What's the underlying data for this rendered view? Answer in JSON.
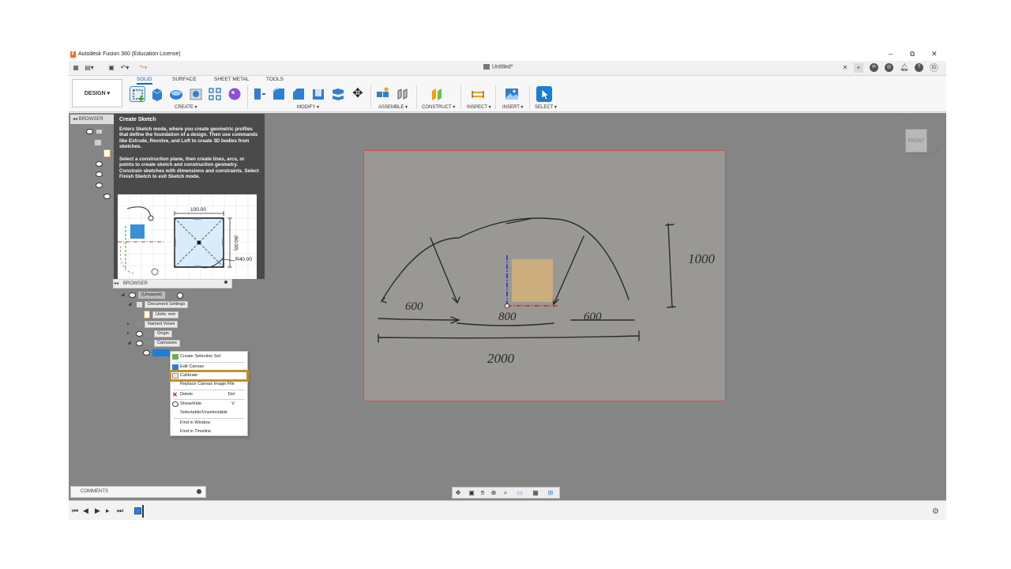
{
  "window": {
    "title": "Autodesk Fusion 360 (Education License)",
    "controls": [
      "–",
      "⧉",
      "✕"
    ]
  },
  "tabbar": {
    "doc_title": "Untitled*",
    "user_initials": "ID"
  },
  "ribbon": {
    "workspace": "DESIGN ▾",
    "tabs": [
      "SOLID",
      "SURFACE",
      "SHEET METAL",
      "TOOLS"
    ],
    "groups": [
      "CREATE ▾",
      "MODIFY ▾",
      "ASSEMBLE ▾",
      "CONSTRUCT ▾",
      "INSPECT ▾",
      "INSERT ▾",
      "SELECT ▾"
    ]
  },
  "browser": {
    "header": "BROWSER"
  },
  "tooltip": {
    "title": "Create Sketch",
    "para1": "Enters Sketch mode, where you create geometric profiles that define the foundation of a design. Then use commands like Extrude, Revolve, and Loft to create 3D bodies from sketches.",
    "para2": "Select a construction plane, then create lines, arcs, or points to create sketch and construction geometry. Constrain sketches with dimensions and constraints. Select Finish Sketch to exit Sketch mode.",
    "dim_top": "100.00",
    "dim_right": "(60.00)",
    "dim_radius": "R40.00"
  },
  "browser2": {
    "header": "BROWSER",
    "root": "(Unsaved)",
    "document_settings": "Document Settings",
    "units": "Units: mm",
    "named_views": "Named Views",
    "origin": "Origin",
    "canvases": "Canvases"
  },
  "context_menu": {
    "items": [
      {
        "label": "Create Selection Set",
        "shortcut": ""
      },
      {
        "label": "Edit Canvas",
        "shortcut": ""
      },
      {
        "label": "Calibrate",
        "shortcut": ""
      },
      {
        "label": "Replace Canvas Image File",
        "shortcut": ""
      },
      {
        "label": "Delete",
        "shortcut": "Del"
      },
      {
        "label": "Show/Hide",
        "shortcut": "V"
      },
      {
        "label": "Selectable/Unselectable",
        "shortcut": ""
      },
      {
        "label": "Find in Window",
        "shortcut": ""
      },
      {
        "label": "Find in Timeline",
        "shortcut": ""
      }
    ]
  },
  "viewcube": {
    "face": "FRONT"
  },
  "comments": {
    "label": "COMMENTS"
  },
  "sketch_labels": {
    "left": "600",
    "center": "800",
    "right": "600",
    "total": "2000",
    "height": "1000"
  },
  "colors": {
    "accent": "#0a6cbf",
    "highlight": "#c0922c",
    "canvas_border": "#d25050"
  }
}
